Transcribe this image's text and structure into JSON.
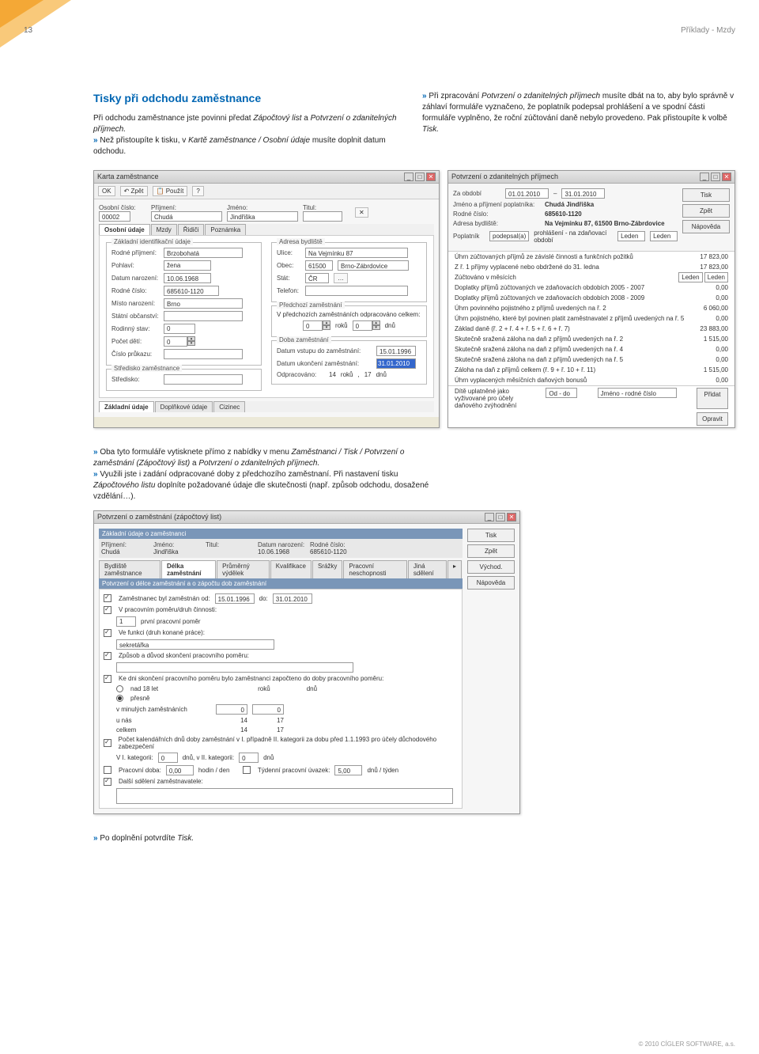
{
  "page_number": "13",
  "header_right": "Příklady - Mzdy",
  "footer": "© 2010 CÍGLER SOFTWARE, a.s.",
  "h2": "Tisky při odchodu zaměstnance",
  "left_col_p1_a": "Při odchodu zaměstnance jste povinni předat ",
  "left_col_p1_i1": "Zápočtový list",
  "left_col_p1_b": " a ",
  "left_col_p1_i2": "Potvrzení o zdanitelných příjmech.",
  "left_col_p2_a": " Než přistoupíte k tisku, v ",
  "left_col_p2_i": "Kartě zaměstnance / Osobní údaje",
  "left_col_p2_b": " musíte doplnit datum odchodu.",
  "right_col_p1_a": " Při zpracování ",
  "right_col_p1_i": "Potvrzení o zdanitelných příjmech",
  "right_col_p1_b": " musíte dbát na to, aby bylo správně v záhlaví formuláře vyznačeno, že poplatník podepsal prohlášení a ve spodní části formuláře vyplněno, že roční zúčtování daně nebylo provedeno. Pak přistoupíte k volbě ",
  "right_col_p1_i2": "Tisk.",
  "mid_p1_a": " Oba tyto formuláře vytisknete přímo z nabídky v menu ",
  "mid_p1_i": "Zaměstnanci / Tisk / Potvrzení o zaměstnání (Zápočtový list)",
  "mid_p1_b": " a ",
  "mid_p1_i2": "Potvrzení o zdanitelných příjmech.",
  "mid_p2_a": " Využili jste i zadání odpracované doby z předchozího zaměstnaní. Při nastavení tisku ",
  "mid_p2_i": "Zápočtového listu",
  "mid_p2_b": " doplníte požadované údaje dle skutečnosti (např. způsob odchodu, dosažené vzdělání…).",
  "end_p_a": " Po doplnění potvrdíte ",
  "end_p_i": "Tisk.",
  "bullet": "»",
  "s1": {
    "title": "Karta zaměstnance",
    "ok": "OK",
    "zpet": "Zpět",
    "pouzit": "Použít",
    "tabs": [
      "Osobní údaje",
      "Mzdy",
      "Řidiči",
      "Poznámka"
    ],
    "oscislo_l": "Osobní číslo:",
    "oscislo": "00002",
    "prijmeni_l": "Příjmení:",
    "prijmeni": "Chudá",
    "jmeno_l": "Jméno:",
    "jmeno": "Jindřiška",
    "titul_l": "Titul:",
    "g1": "Základní identifikační údaje",
    "rodpr_l": "Rodné příjmení:",
    "rodpr": "Brzobohatá",
    "pohlavi_l": "Pohlaví:",
    "pohlavi": "žena",
    "datnar_l": "Datum narození:",
    "datnar": "10.06.1968",
    "rc_l": "Rodné číslo:",
    "rc": "685610-1120",
    "mistnar_l": "Místo narození:",
    "mistnar": "Brno",
    "statob_l": "Státní občanství:",
    "rodstav_l": "Rodinný stav:",
    "rodstav": "0",
    "pocdeti_l": "Počet dětí:",
    "pocdeti": "0",
    "cprukaz_l": "Číslo průkazu:",
    "g1b": "Středisko zaměstnance",
    "stredisko_l": "Středisko:",
    "g2": "Adresa bydliště",
    "ulice_l": "Ulice:",
    "ulice": "Na Vejmínku 87",
    "obec_l": "Obec:",
    "psc": "61500",
    "obec": "Brno-Zábrdovice",
    "stat_l": "Stát:",
    "stat": "ČR",
    "tel_l": "Telefon:",
    "g3": "Předchozí zaměstnání",
    "predch": "V předchozích zaměstnáních odpracováno celkem:",
    "roku": "roků",
    "dnu": "dnů",
    "roku_v": "0",
    "dnu_v": "0",
    "g4": "Doba zaměstnání",
    "dvstup_l": "Datum vstupu do zaměstnání:",
    "dvstup": "15.01.1996",
    "dukon_l": "Datum ukončení zaměstnání:",
    "dukon": "31.01.2010",
    "odprac_l": "Odpracováno:",
    "odprac_r": "14",
    "odprac_d": "17",
    "bottabs": [
      "Základní údaje",
      "Doplňkové údaje",
      "Cizinec"
    ]
  },
  "s2": {
    "title": "Potvrzení o zdanitelných příjmech",
    "zaobdobi": "Za období",
    "od": "01.01.2010",
    "do": "31.01.2010",
    "jmeno_l": "Jméno a příjmení poplatníka:",
    "jmeno": "Chudá Jindřiška",
    "rc_l": "Rodné číslo:",
    "rc": "685610-1120",
    "adr_l": "Adresa bydliště:",
    "adr": "Na Vejmínku 87, 61500 Brno-Zábrdovice",
    "pop_l": "Poplatník ",
    "pop_s": "podepsal(a)",
    "pop_m": "prohlášení - na zdaňovací období",
    "mes": "Leden",
    "r1": "Úhrn zúčtovaných příjmů ze závislé činnosti a funkčních požitků",
    "v1": "17 823,00",
    "r2": "Z ř. 1 příjmy vyplacené nebo obdržené do 31. ledna",
    "v2": "17 823,00",
    "r3": "Zúčtováno v měsících",
    "v3a": "Leden",
    "v3b": "Leden",
    "r4": "Doplatky příjmů zúčtovaných ve zdaňovacích obdobích 2005 - 2007",
    "v4": "0,00",
    "r5": "Doplatky příjmů zúčtovaných ve zdaňovacích obdobích 2008 - 2009",
    "v5": "0,00",
    "r6": "Úhrn povinného pojistného z příjmů uvedených na ř. 2",
    "v6": "6 060,00",
    "r7": "Úhrn pojistného, které byl povinen platit zaměstnavatel z příjmů uvedených na ř. 5",
    "v7": "0,00",
    "r8": "Základ daně (ř. 2 + ř. 4 + ř. 5 + ř. 6 + ř. 7)",
    "v8": "23 883,00",
    "r9": "Skutečně sražená záloha na daň z příjmů uvedených na ř. 2",
    "v9": "1 515,00",
    "r10": "Skutečně sražená záloha na daň z příjmů uvedených na ř. 4",
    "v10": "0,00",
    "r11": "Skutečně sražená záloha na daň z příjmů uvedených na ř. 5",
    "v11": "0,00",
    "r12": "Záloha na daň z příjmů celkem (ř. 9 + ř. 10 + ř. 11)",
    "v12": "1 515,00",
    "r13": "Úhrn vyplacených měsíčních daňových bonusů",
    "v13": "0,00",
    "r14a": "Dítě uplatněné jako vyživované pro účely daňového zvýhodnění",
    "r14b": "Od - do",
    "r14c": "Jméno - rodné číslo",
    "btn_tisk": "Tisk",
    "btn_zpet": "Zpět",
    "btn_nap": "Nápověda",
    "btn_pridat": "Přidat",
    "btn_opr": "Opravit"
  },
  "s3": {
    "title": "Potvrzení o zaměstnání (zápočtový list)",
    "g1": "Základní údaje o zaměstnanci",
    "prijmeni_l": "Příjmení:",
    "prijmeni": "Chudá",
    "jmeno_l": "Jméno:",
    "jmeno": "Jindřiška",
    "titul_l": "Titul:",
    "datnar_l": "Datum narození:",
    "datnar": "10.06.1968",
    "rc_l": "Rodné číslo:",
    "rc": "685610-1120",
    "tabs": [
      "Bydliště zaměstnance",
      "Délka zaměstnání",
      "Průměrný výdělek",
      "Kvalifikace",
      "Srážky",
      "Pracovní neschopnosti",
      "Jiná sdělení"
    ],
    "g2": "Potvrzení o délce zaměstnání a o zápočtu dob zaměstnání",
    "c1": "Zaměstnanec byl zaměstnán od:",
    "c1a": "15.01.1996",
    "c1b": "do:",
    "c1c": "31.01.2010",
    "c2": "V pracovním poměru/druh činnosti:",
    "c2v": "1",
    "c2t": "první pracovní poměr",
    "c3": "Ve funkci (druh konané práce):",
    "c3v": "sekretářka",
    "c4": "Způsob a důvod skončení pracovního poměru:",
    "c5": "Ke dni skončení pracovního poměru bylo zaměstnanci započteno do doby pracovního poměru:",
    "c5a": "nad 18 let",
    "c5b": "přesně",
    "roku": "roků",
    "dnu": "dnů",
    "row1": "v minulých zaměstnáních",
    "r1a": "0",
    "r1b": "0",
    "row2": "u nás",
    "r2a": "14",
    "r2b": "17",
    "row3": "celkem",
    "r3a": "14",
    "r3b": "17",
    "c6": "Počet kalendářních dnů doby zaměstnání v I. případně II. kategorii za dobu před 1.1.1993 pro účely důchodového zabezpečení",
    "c6a": "V I. kategorii:",
    "c6av": "0",
    "c6b": "dnů, v II. kategorii:",
    "c6bv": "0",
    "c6c": "dnů",
    "c7": "Pracovní doba:",
    "c7v": "0,00",
    "c7u": "hodin / den",
    "c7b": "Týdenní pracovní úvazek:",
    "c7bv": "5,00",
    "c7bu": "dnů / týden",
    "c8": "Další sdělení zaměstnavatele:",
    "btns": [
      "Tisk",
      "Zpět",
      "Východ.",
      "Nápověda"
    ]
  }
}
